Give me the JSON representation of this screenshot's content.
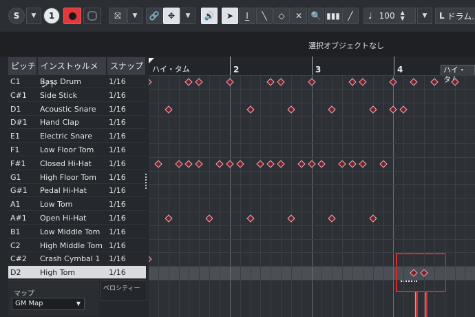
{
  "toolbar": {
    "solo_label": "S",
    "step_label": "1",
    "quantize_value": "100",
    "length_label": "L",
    "track_label": "ドラム."
  },
  "info": {
    "message": "選択オブジェクトなし"
  },
  "list": {
    "headers": {
      "pitch": "ピッチ",
      "instrument": "インストゥルメント",
      "snap": "スナップ"
    },
    "rows": [
      {
        "pitch": "C1",
        "instrument": "Bass Drum",
        "snap": "1/16"
      },
      {
        "pitch": "C#1",
        "instrument": "Side Stick",
        "snap": "1/16"
      },
      {
        "pitch": "D1",
        "instrument": "Acoustic Snare",
        "snap": "1/16"
      },
      {
        "pitch": "D#1",
        "instrument": "Hand Clap",
        "snap": "1/16"
      },
      {
        "pitch": "E1",
        "instrument": "Electric Snare",
        "snap": "1/16"
      },
      {
        "pitch": "F1",
        "instrument": "Low Floor Tom",
        "snap": "1/16"
      },
      {
        "pitch": "F#1",
        "instrument": "Closed Hi-Hat",
        "snap": "1/16"
      },
      {
        "pitch": "G1",
        "instrument": "High Floor Tom",
        "snap": "1/16"
      },
      {
        "pitch": "G#1",
        "instrument": "Pedal Hi-Hat",
        "snap": "1/16"
      },
      {
        "pitch": "A1",
        "instrument": "Low Tom",
        "snap": "1/16"
      },
      {
        "pitch": "A#1",
        "instrument": "Open Hi-Hat",
        "snap": "1/16"
      },
      {
        "pitch": "B1",
        "instrument": "Low Middle Tom",
        "snap": "1/16"
      },
      {
        "pitch": "C2",
        "instrument": "High Middle Tom",
        "snap": "1/16"
      },
      {
        "pitch": "C#2",
        "instrument": "Crash Cymbal 1",
        "snap": "1/16"
      },
      {
        "pitch": "D2",
        "instrument": "High Tom",
        "snap": "1/16"
      }
    ],
    "selected_index": 14
  },
  "map": {
    "label": "マップ",
    "value": "GM Map"
  },
  "velocity": {
    "label": "ベロシティー"
  },
  "ruler": {
    "bars": [
      "2",
      "3",
      "4"
    ],
    "marker_left": "ハイ・タム",
    "marker_right": "ハイ・タム"
  },
  "colors": {
    "note": "#7c1f28",
    "highlight": "#e0262b",
    "record": "#e0383b"
  }
}
